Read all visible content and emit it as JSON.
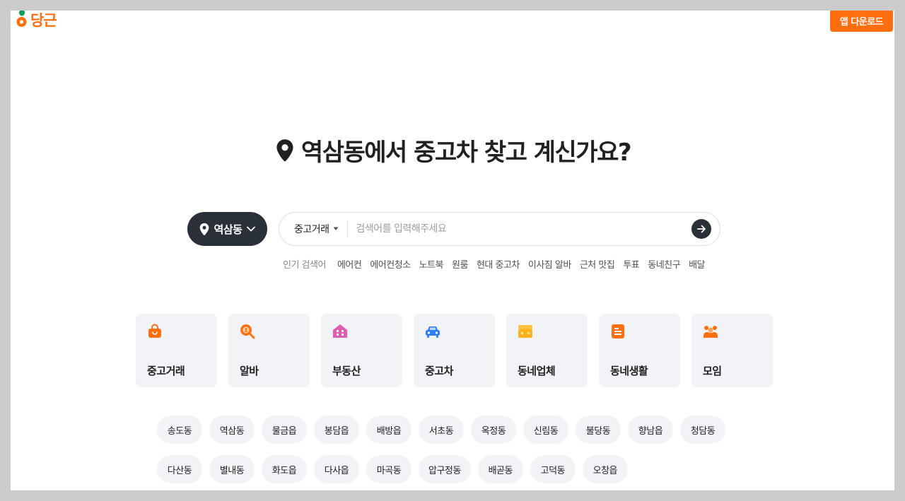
{
  "header": {
    "logo_text": "당근",
    "app_download_label": "앱 다운로드"
  },
  "headline": {
    "text": "역삼동에서 중고차 찾고 계신가요?"
  },
  "search": {
    "location_label": "역삼동",
    "category_label": "중고거래",
    "placeholder": "검색어를 입력해주세요",
    "popular_label": "인기 검색어",
    "popular_keywords": [
      "에어컨",
      "에어컨청소",
      "노트북",
      "원룸",
      "현대 중고차",
      "이사짐 알바",
      "근처 맛집",
      "투표",
      "동네친구",
      "배달"
    ]
  },
  "categories": [
    {
      "label": "중고거래",
      "icon": "shopping-bag-icon"
    },
    {
      "label": "알바",
      "icon": "job-search-icon"
    },
    {
      "label": "부동산",
      "icon": "house-icon"
    },
    {
      "label": "중고차",
      "icon": "car-icon"
    },
    {
      "label": "동네업체",
      "icon": "store-icon"
    },
    {
      "label": "동네생활",
      "icon": "document-icon"
    },
    {
      "label": "모임",
      "icon": "group-icon"
    }
  ],
  "regions": [
    "송도동",
    "역삼동",
    "물금읍",
    "봉담읍",
    "배방읍",
    "서초동",
    "옥정동",
    "신림동",
    "불당동",
    "향남읍",
    "청담동",
    "다산동",
    "별내동",
    "화도읍",
    "다사읍",
    "마곡동",
    "압구정동",
    "배곧동",
    "고덕동",
    "오창읍"
  ],
  "colors": {
    "brand": "#ff6f0f",
    "dark": "#2a3038",
    "chip_bg": "#f2f3f6"
  }
}
